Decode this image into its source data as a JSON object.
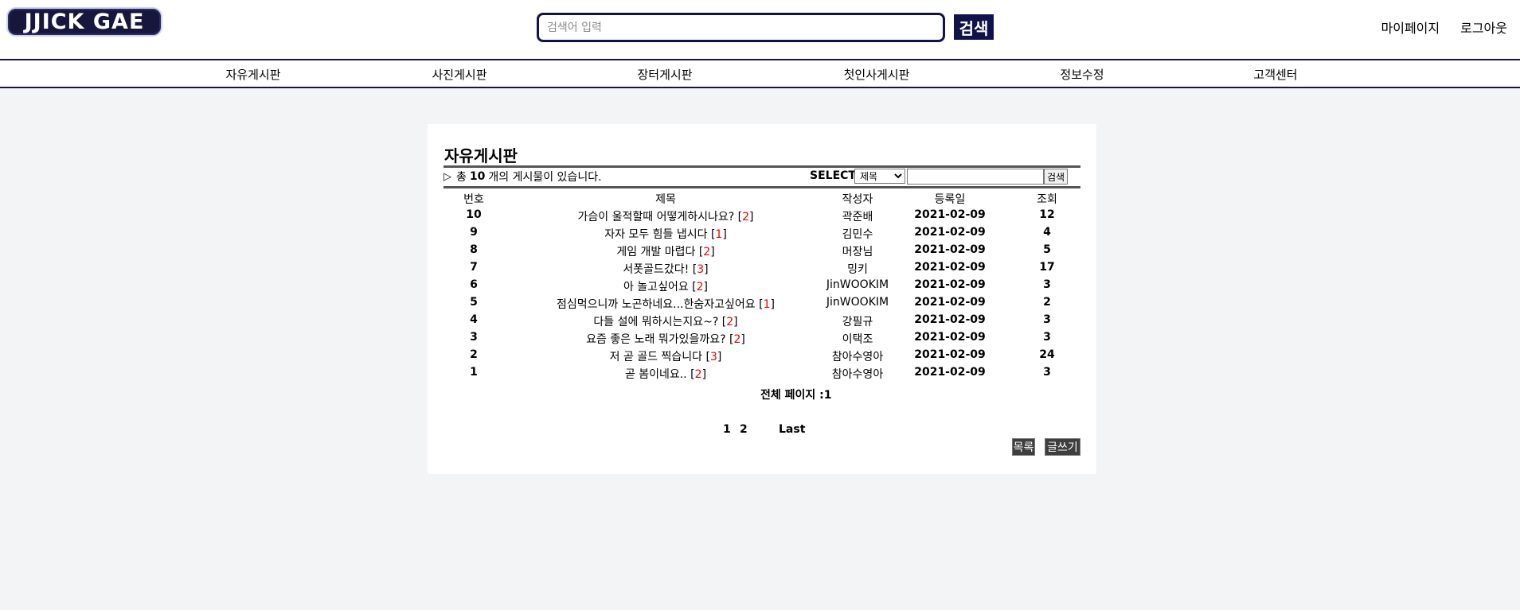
{
  "header": {
    "logo_text": "JJICK GAE",
    "search_placeholder": "검색어 입력",
    "search_button": "검색",
    "links": [
      "마이페이지",
      "로그아웃"
    ]
  },
  "nav": {
    "items": [
      "자유게시판",
      "사진게시판",
      "장터게시판",
      "첫인사게시판",
      "정보수정",
      "고객센터"
    ]
  },
  "board": {
    "title": "자유게시판",
    "info_prefix": "총",
    "count": "10",
    "info_suffix": "개의 게시물이 있습니다.",
    "select_label": "SELECT",
    "select_value": "제목",
    "search_button": "검색",
    "columns": [
      "번호",
      "제목",
      "작성자",
      "등록일",
      "조회"
    ],
    "rows": [
      {
        "no": "10",
        "title": "가슴이 울적할때 어떻게하시나요?",
        "comments": "2",
        "author": "곽준배",
        "date": "2021-02-09",
        "views": "12"
      },
      {
        "no": "9",
        "title": "자자 모두 힘들 냅시다",
        "comments": "1",
        "author": "김민수",
        "date": "2021-02-09",
        "views": "4"
      },
      {
        "no": "8",
        "title": "게임 개발 마렵다",
        "comments": "2",
        "author": "머장님",
        "date": "2021-02-09",
        "views": "5"
      },
      {
        "no": "7",
        "title": "서폿골드갔다!",
        "comments": "3",
        "author": "밍키",
        "date": "2021-02-09",
        "views": "17"
      },
      {
        "no": "6",
        "title": "아 놀고싶어요",
        "comments": "2",
        "author": "JinWOOKIM",
        "date": "2021-02-09",
        "views": "3"
      },
      {
        "no": "5",
        "title": "점심먹으니까 노곤하네요...한숨자고싶어요",
        "comments": "1",
        "author": "JinWOOKIM",
        "date": "2021-02-09",
        "views": "2"
      },
      {
        "no": "4",
        "title": "다들 설에 뭐하시는지요~?",
        "comments": "2",
        "author": "강필규",
        "date": "2021-02-09",
        "views": "3"
      },
      {
        "no": "3",
        "title": "요즘 좋은 노래 뭐가있을까요?",
        "comments": "2",
        "author": "이택조",
        "date": "2021-02-09",
        "views": "3"
      },
      {
        "no": "2",
        "title": "저 곧 골드 찍습니다",
        "comments": "3",
        "author": "참아수영아",
        "date": "2021-02-09",
        "views": "24"
      },
      {
        "no": "1",
        "title": "곧 봄이네요..",
        "comments": "2",
        "author": "참아수영아",
        "date": "2021-02-09",
        "views": "3"
      }
    ],
    "total_pages": "전체 페이지 :1",
    "pagination": [
      "1",
      "2",
      "Last"
    ],
    "list_button": "목록",
    "write_button": "글쓰기"
  }
}
